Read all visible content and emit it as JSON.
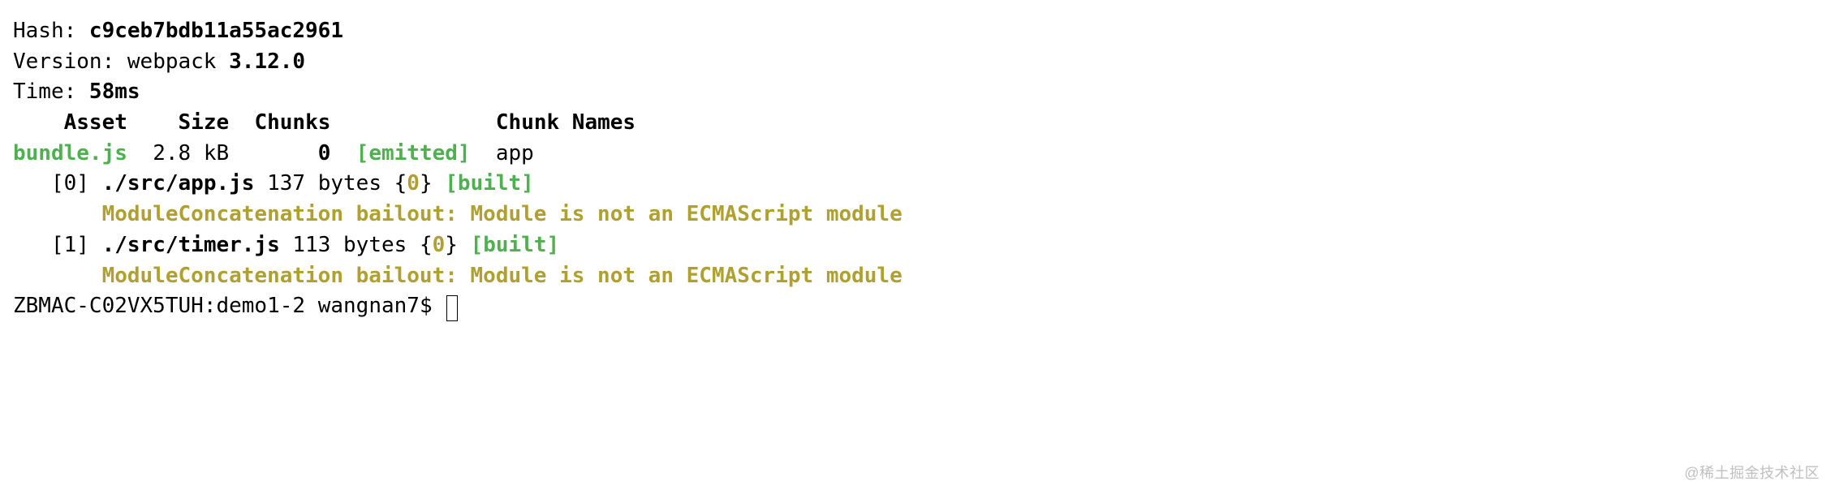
{
  "header": {
    "hash_label": "Hash: ",
    "hash_value": "c9ceb7bdb11a55ac2961",
    "version_label": "Version: ",
    "version_tool": "webpack ",
    "version_value": "3.12.0",
    "time_label": "Time: ",
    "time_value": "58ms"
  },
  "columns": {
    "asset": "Asset",
    "size": "Size",
    "chunks": "Chunks",
    "chunk_names": "Chunk Names"
  },
  "asset_row": {
    "name": "bundle.js",
    "size": "2.8 kB",
    "chunk": "0",
    "status": "[emitted]",
    "chunk_name": "app"
  },
  "modules": [
    {
      "index": "[0]",
      "path": "./src/app.js",
      "size": "137 bytes",
      "brace_open": "{",
      "chunk": "0",
      "brace_close": "}",
      "status": "[built]",
      "bailout": "ModuleConcatenation bailout: Module is not an ECMAScript module"
    },
    {
      "index": "[1]",
      "path": "./src/timer.js",
      "size": "113 bytes",
      "brace_open": "{",
      "chunk": "0",
      "brace_close": "}",
      "status": "[built]",
      "bailout": "ModuleConcatenation bailout: Module is not an ECMAScript module"
    }
  ],
  "prompt": {
    "host": "ZBMAC-C02VX5TUH",
    "separator": ":",
    "dir": "demo1-2",
    "user": "wangnan7",
    "sigil": "$"
  },
  "watermark": "@稀土掘金技术社区"
}
